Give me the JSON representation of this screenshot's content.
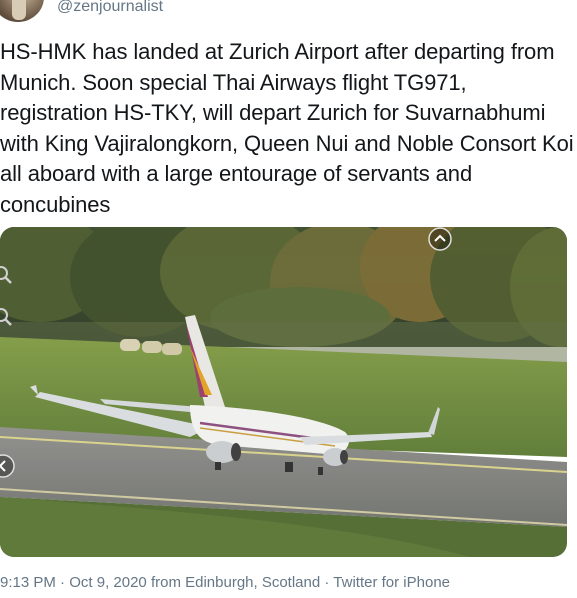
{
  "author": {
    "handle": "@zenjournalist",
    "avatar_icon": "profile-photo"
  },
  "tweet": {
    "text": "HS-HMK has landed at Zurich Airport after departing from Munich. Soon special Thai Airways flight TG971, registration HS-TKY, will depart Zurich for Suvarnabhumi with King Vajiralongkorn, Queen Nui and Noble Consort Koi all aboard with a large entourage of servants and concubines"
  },
  "media": {
    "description_icon": "airplane-photo",
    "controls": {
      "zoom_icon": "magnifier-icon",
      "collapse_icon": "chevron-up-circle-icon",
      "prev_icon": "chevron-left-circle-icon"
    }
  },
  "meta": {
    "time": "9:13 PM",
    "sep1": " · ",
    "date": "Oct 9, 2020",
    "location": " from Edinburgh, Scotland",
    "sep2": " · ",
    "source": "Twitter for iPhone"
  },
  "colors": {
    "text": "#14171a",
    "secondary": "#657786"
  }
}
